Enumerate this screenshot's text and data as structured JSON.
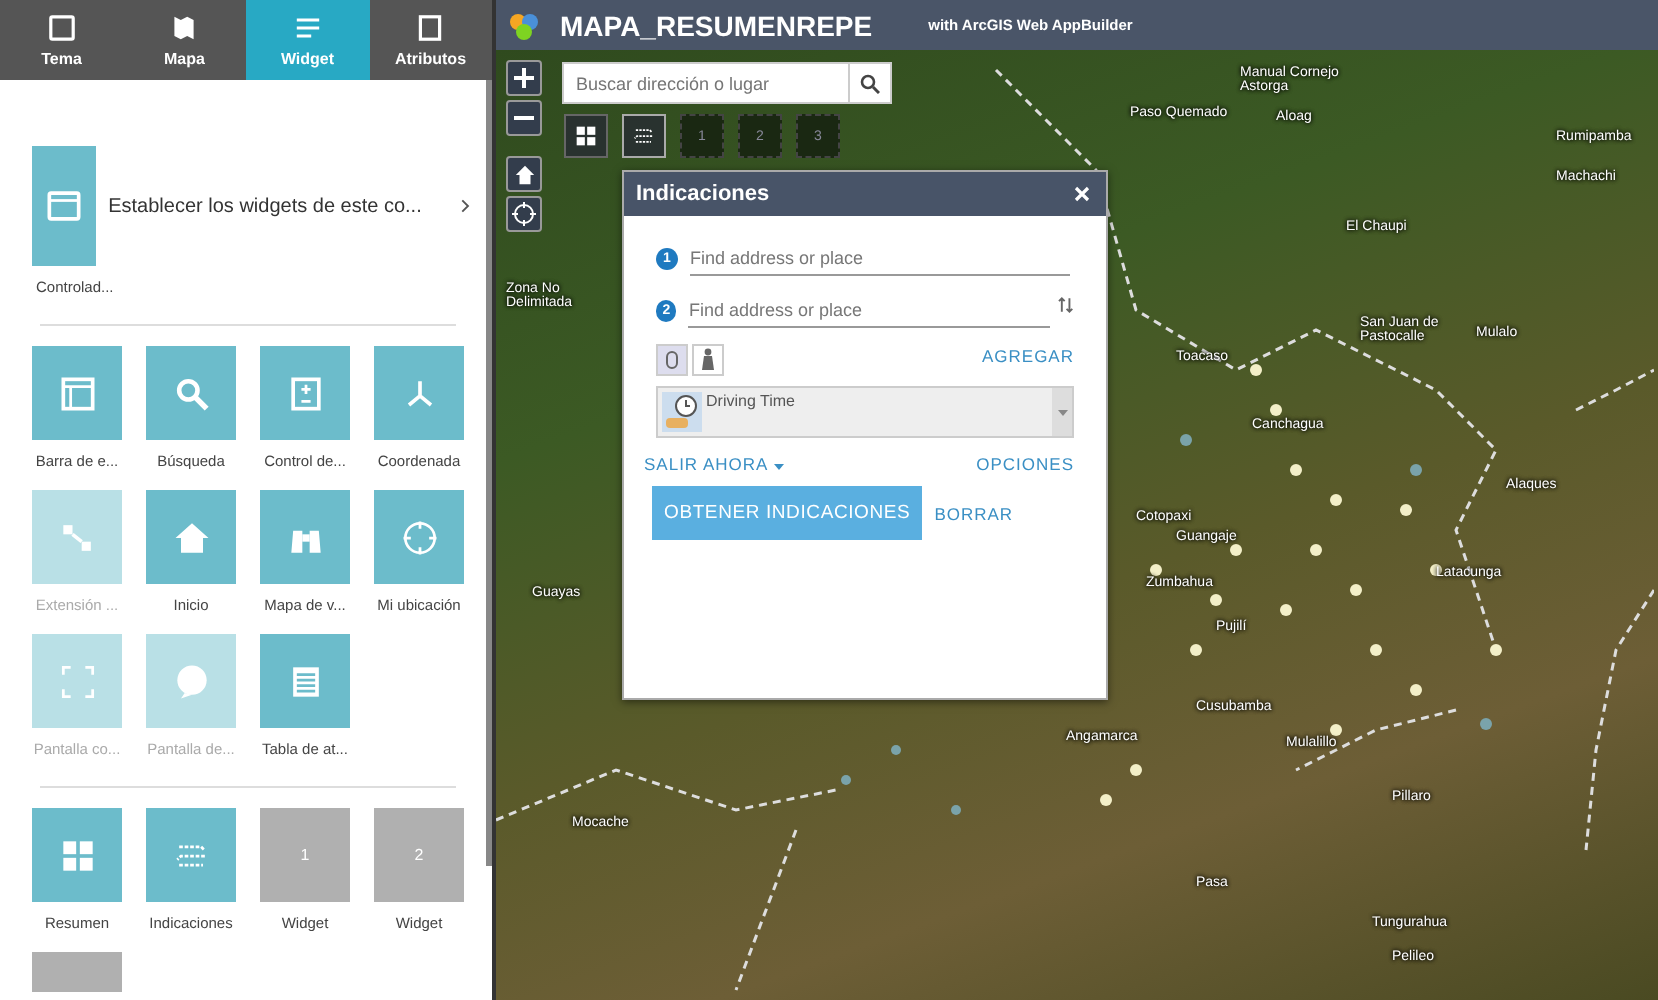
{
  "side_tabs": [
    {
      "label": "Tema",
      "selected": false
    },
    {
      "label": "Mapa",
      "selected": false
    },
    {
      "label": "Widget",
      "selected": true
    },
    {
      "label": "Atributos",
      "selected": false
    }
  ],
  "controller": {
    "label": "Controlad...",
    "description": "Establecer los widgets de este co..."
  },
  "widgets": [
    {
      "label": "Barra de e...",
      "disabled": false
    },
    {
      "label": "Búsqueda",
      "disabled": false
    },
    {
      "label": "Control de...",
      "disabled": false
    },
    {
      "label": "Coordenada",
      "disabled": false
    },
    {
      "label": "Extensión ...",
      "disabled": true
    },
    {
      "label": "Inicio",
      "disabled": false
    },
    {
      "label": "Mapa de v...",
      "disabled": false
    },
    {
      "label": "Mi ubicación",
      "disabled": false
    },
    {
      "label": "Pantalla co...",
      "disabled": true
    },
    {
      "label": "Pantalla de...",
      "disabled": true
    },
    {
      "label": "Tabla de at...",
      "disabled": false
    }
  ],
  "placed_widgets": [
    {
      "kind": "widget",
      "label": "Resumen"
    },
    {
      "kind": "widget",
      "label": "Indicaciones"
    },
    {
      "kind": "slot",
      "number": "1",
      "label": "Widget"
    },
    {
      "kind": "slot",
      "number": "2",
      "label": "Widget"
    },
    {
      "kind": "slot"
    }
  ],
  "app_header": {
    "title": "MAPA_RESUMENREPE",
    "subtitle": "with ArcGIS Web AppBuilder"
  },
  "search": {
    "placeholder": "Buscar dirección o lugar"
  },
  "toolbar_slots": [
    "1",
    "2",
    "3"
  ],
  "directions": {
    "title": "Indicaciones",
    "stops": [
      {
        "number": "1",
        "placeholder": "Find address or place"
      },
      {
        "number": "2",
        "placeholder": "Find address or place"
      }
    ],
    "add_label": "AGREGAR",
    "travel_mode": "Driving Time",
    "depart": "SALIR AHORA",
    "options": "OPCIONES",
    "get_button": "OBTENER INDICACIONES",
    "clear_button": "BORRAR"
  },
  "map_labels": [
    "Manual Cornejo Astorga",
    "Paso Quemado",
    "Aloag",
    "Rumipamba",
    "Machachi",
    "El Chaupi",
    "Zona No Delimitada",
    "San Juan de Pastocalle",
    "Mulalo",
    "Toacaso",
    "Canchagua",
    "Alaques",
    "Cotopaxi",
    "Guangaje",
    "Zumbahua",
    "Latacunga",
    "Pujilí",
    "Guayas",
    "Cusubamba",
    "Angamarca",
    "Mulalillo",
    "Pillaro",
    "Pasa",
    "Tungurahua",
    "Pelileo",
    "Mocache"
  ]
}
